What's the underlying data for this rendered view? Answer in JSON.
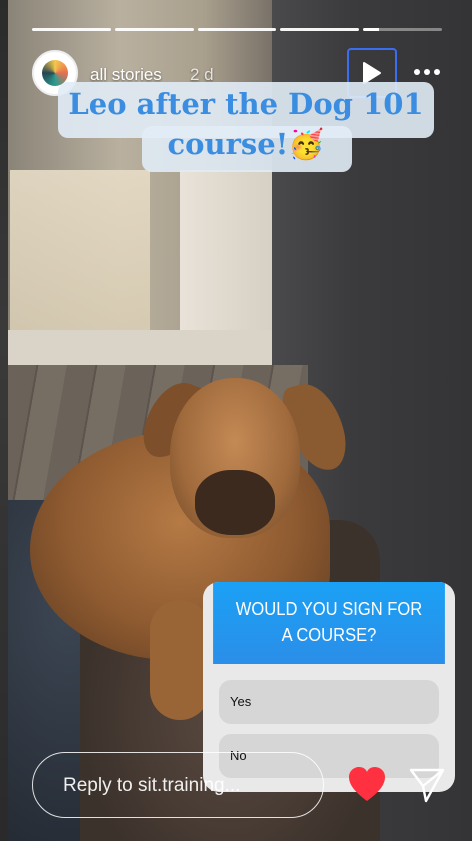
{
  "story": {
    "progress_segments": 5,
    "current_segment_fraction": 0.2,
    "user": "all stories",
    "time_ago": "2 d",
    "caption": "Leo after the Dog 101 course!🥳"
  },
  "poll": {
    "question": "WOULD YOU SIGN FOR A COURSE?",
    "options": [
      "Yes",
      "No"
    ]
  },
  "footer": {
    "reply_placeholder": "Reply to sit.training..."
  },
  "icons": {
    "play": "play-icon",
    "more": "more-options-icon",
    "like": "heart-icon",
    "send": "send-icon"
  },
  "colors": {
    "poll_header": "#1aa1f5",
    "caption_text": "#3a8de0",
    "heart": "#ff3040",
    "focus_outline": "#3a6df0"
  }
}
